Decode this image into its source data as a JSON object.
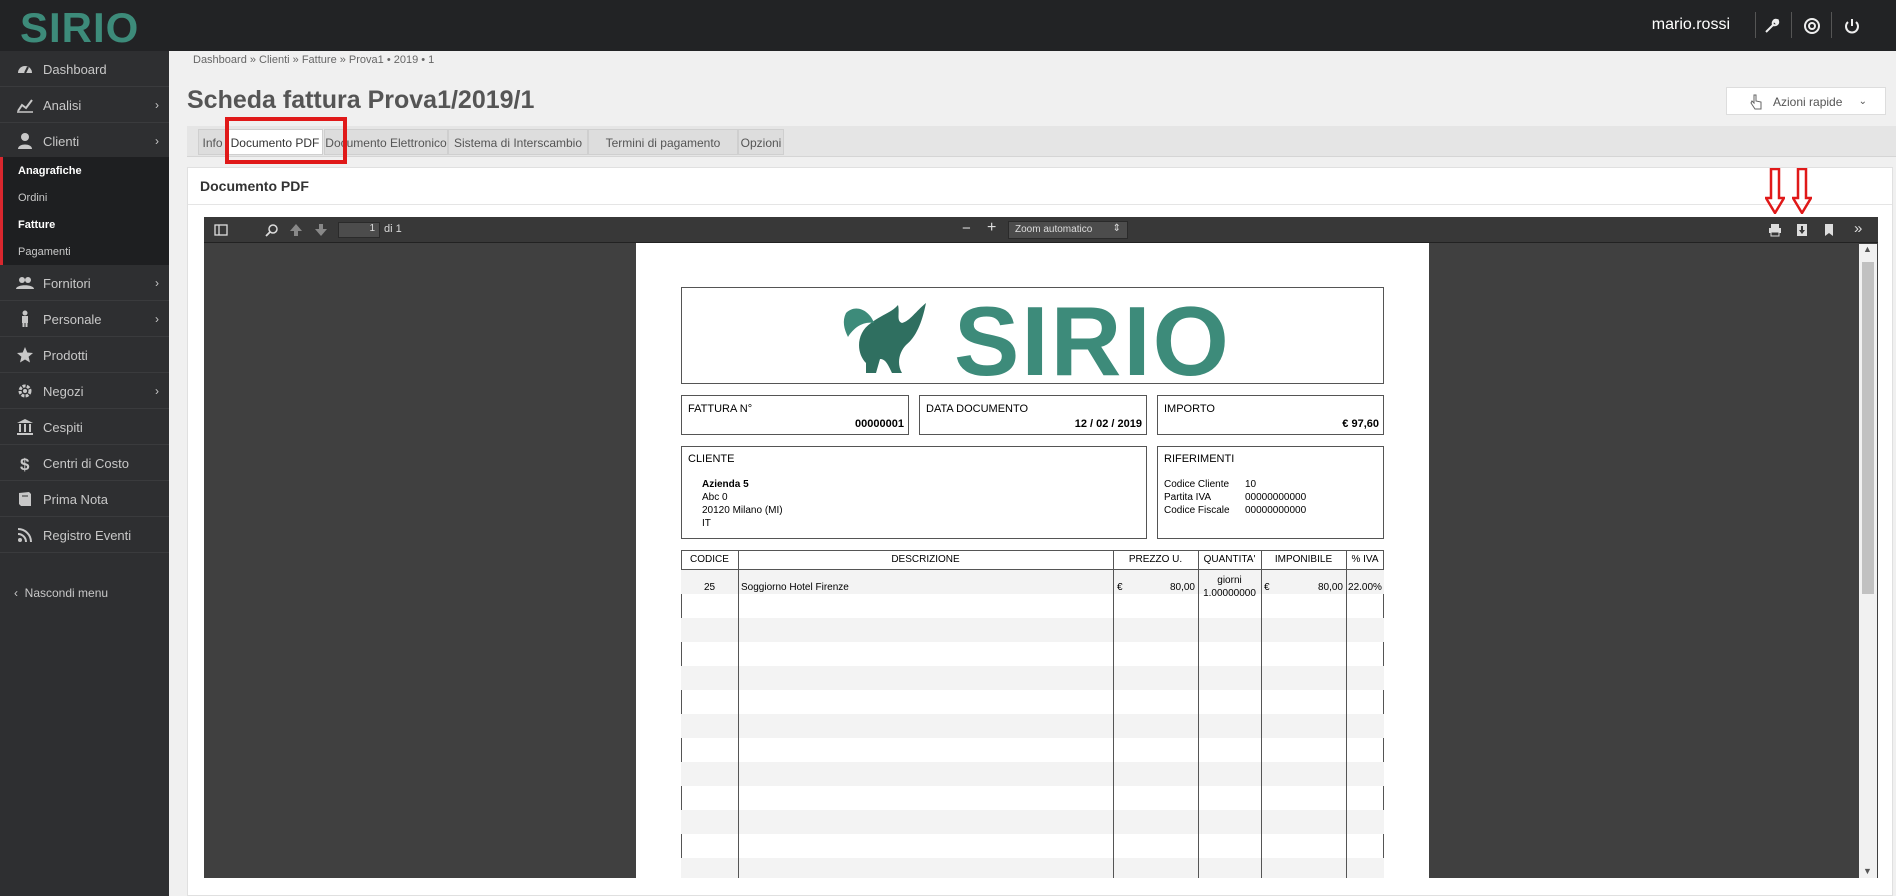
{
  "app": {
    "brand": "SIRIO",
    "user": "mario.rossi"
  },
  "colors": {
    "brand_teal": "#3d8b7a",
    "topbar": "#222325",
    "sidebar": "#2e2f31",
    "highlight_red": "#e01919"
  },
  "sidebar": {
    "items": [
      {
        "label": "Dashboard",
        "icon": "dashboard-icon"
      },
      {
        "label": "Analisi",
        "icon": "chart-line-icon"
      },
      {
        "label": "Clienti",
        "icon": "user-icon"
      },
      {
        "label": "Fornitori",
        "icon": "users-icon"
      },
      {
        "label": "Personale",
        "icon": "person-icon"
      },
      {
        "label": "Prodotti",
        "icon": "star-icon"
      },
      {
        "label": "Negozi",
        "icon": "gear-icon"
      },
      {
        "label": "Cespiti",
        "icon": "bank-icon"
      },
      {
        "label": "Centri di Costo",
        "icon": "dollar-icon"
      },
      {
        "label": "Prima Nota",
        "icon": "book-icon"
      },
      {
        "label": "Registro Eventi",
        "icon": "rss-icon"
      }
    ],
    "subitems": [
      {
        "label": "Anagrafiche"
      },
      {
        "label": "Ordini"
      },
      {
        "label": "Fatture"
      },
      {
        "label": "Pagamenti"
      }
    ],
    "hide_menu": "Nascondi menu"
  },
  "breadcrumb": "Dashboard » Clienti » Fatture » Prova1 • 2019 • 1",
  "page_title": "Scheda fattura Prova1/2019/1",
  "quick_actions": "Azioni rapide",
  "tabs": [
    {
      "label": "Info"
    },
    {
      "label": "Documento PDF"
    },
    {
      "label": "Documento Elettronico"
    },
    {
      "label": "Sistema di Interscambio"
    },
    {
      "label": "Termini di pagamento"
    },
    {
      "label": "Opzioni"
    }
  ],
  "panel_title": "Documento PDF",
  "viewer": {
    "page_number": "1",
    "page_of": "di 1",
    "zoom": "Zoom automatico"
  },
  "invoice": {
    "brand": "SIRIO",
    "number_label": "FATTURA N°",
    "number": "00000001",
    "date_label": "DATA DOCUMENTO",
    "date": "12 / 02 / 2019",
    "amount_label": "IMPORTO",
    "amount": "€ 97,60",
    "client_label": "CLIENTE",
    "client_name": "Azienda 5",
    "client_line1": "Abc 0",
    "client_line2": "20120 Milano (MI)",
    "client_line3": "IT",
    "refs_label": "RIFERIMENTI",
    "refs": [
      {
        "k": "Codice Cliente",
        "v": "10"
      },
      {
        "k": "Partita IVA",
        "v": "00000000000"
      },
      {
        "k": "Codice Fiscale",
        "v": "00000000000"
      }
    ],
    "columns": [
      "CODICE",
      "DESCRIZIONE",
      "PREZZO U.",
      "QUANTITA'",
      "IMPONIBILE",
      "% IVA"
    ],
    "row": {
      "code": "25",
      "description": "Soggiorno Hotel Firenze",
      "currency": "€",
      "price": "80,00",
      "qty_unit": "giorni",
      "qty": "1.00000000",
      "taxable_currency": "€",
      "taxable": "80,00",
      "vat": "22.00%"
    }
  }
}
